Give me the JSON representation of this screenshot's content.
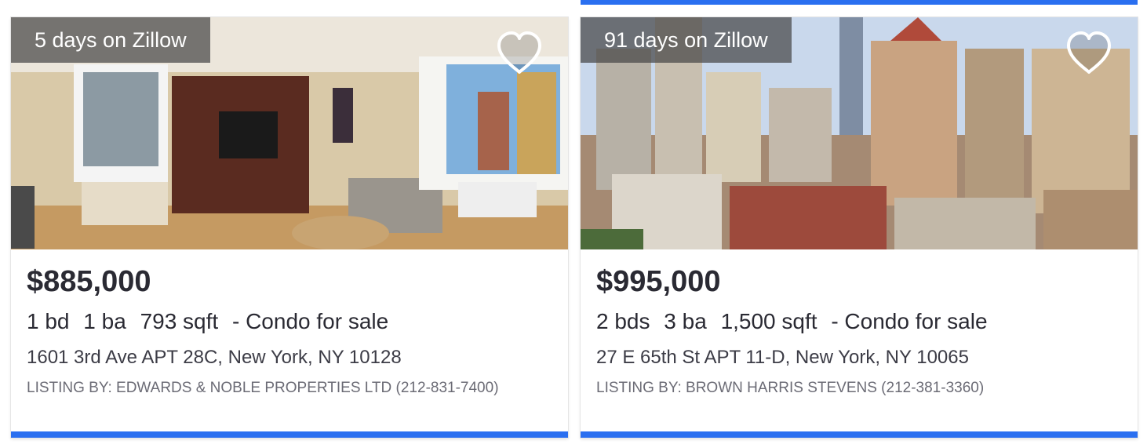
{
  "colors": {
    "accent": "#2a6ff0",
    "text_primary": "#2a2a33",
    "text_muted": "#6b6b75"
  },
  "listings": [
    {
      "badge": "5 days on Zillow",
      "price": "$885,000",
      "beds": "1 bd",
      "baths": "1 ba",
      "sqft": "793 sqft",
      "type": "- Condo for sale",
      "address": "1601 3rd Ave APT 28C, New York, NY 10128",
      "listing_by": "LISTING BY: EDWARDS & NOBLE PROPERTIES LTD (212-831-7400)",
      "photo_icon": "living-room-photo",
      "favorite_icon": "heart-icon"
    },
    {
      "badge": "91 days on Zillow",
      "price": "$995,000",
      "beds": "2 bds",
      "baths": "3 ba",
      "sqft": "1,500 sqft",
      "type": "- Condo for sale",
      "address": "27 E 65th St APT 11-D, New York, NY 10065",
      "listing_by": "LISTING BY: BROWN HARRIS STEVENS (212-381-3360)",
      "photo_icon": "city-skyline-photo",
      "favorite_icon": "heart-icon"
    }
  ]
}
